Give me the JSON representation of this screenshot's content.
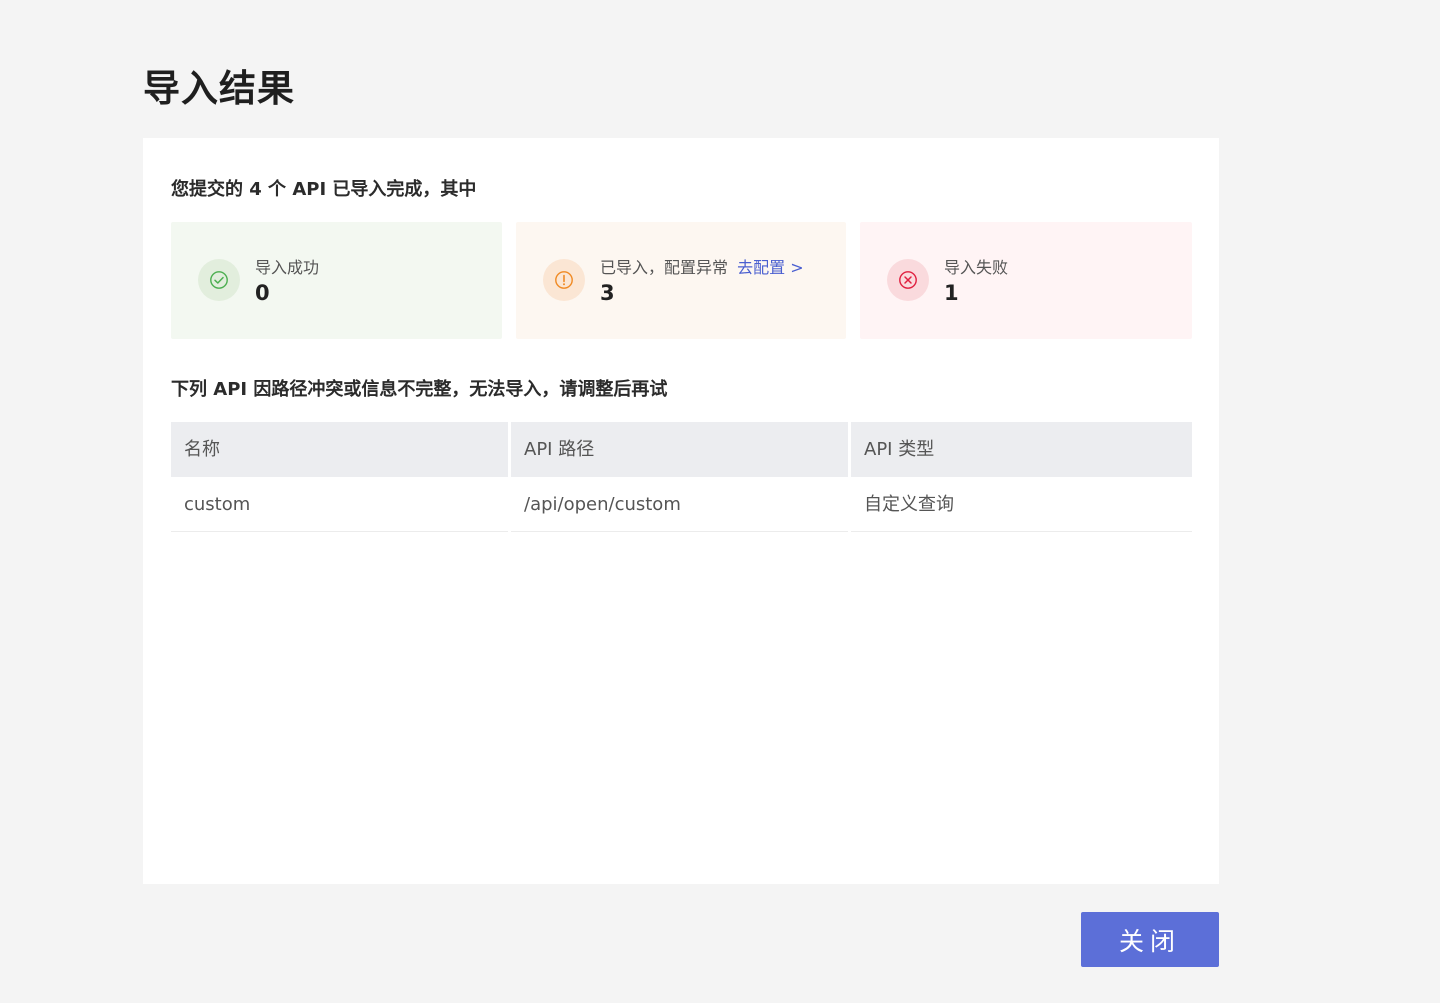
{
  "page": {
    "title": "导入结果"
  },
  "summary": {
    "text": "您提交的 4 个 API 已导入完成，其中"
  },
  "stats": {
    "success": {
      "label": "导入成功",
      "value": "0",
      "icon": "check-circle-icon",
      "color": "#4caf50"
    },
    "warning": {
      "label": "已导入，配置异常",
      "link": "去配置 >",
      "value": "3",
      "icon": "exclamation-circle-icon",
      "color": "#f08a24"
    },
    "failed": {
      "label": "导入失败",
      "value": "1",
      "icon": "x-circle-icon",
      "color": "#e02040"
    }
  },
  "notice": {
    "text": "下列 API 因路径冲突或信息不完整，无法导入，请调整后再试"
  },
  "table": {
    "columns": [
      "名称",
      "API 路径",
      "API 类型"
    ],
    "rows": [
      [
        "custom",
        "/api/open/custom",
        "自定义查询"
      ]
    ]
  },
  "footer": {
    "close_label": "关闭",
    "accent": "#5c6fd8"
  }
}
